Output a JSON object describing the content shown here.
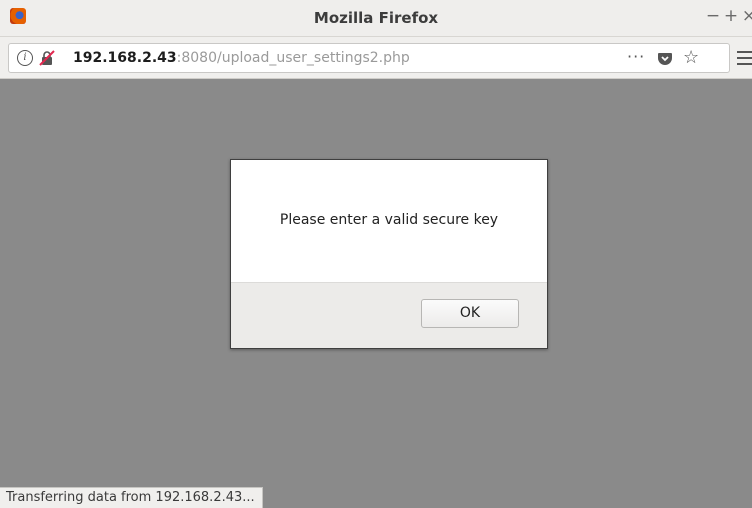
{
  "window": {
    "title": "Mozilla Firefox",
    "controls": {
      "minimize": "−",
      "maximize": "+",
      "close": "×"
    }
  },
  "urlbar": {
    "host": "192.168.2.43",
    "rest": ":8080/upload_user_settings2.php",
    "page_actions": "···",
    "bookmark": "☆"
  },
  "dialog": {
    "message": "Please enter a valid secure key",
    "ok_label": "OK"
  },
  "status": {
    "text": "Transferring data from 192.168.2.43..."
  },
  "colors": {
    "content_overlay": "#8a8a8a",
    "chrome": "#f0efed"
  }
}
